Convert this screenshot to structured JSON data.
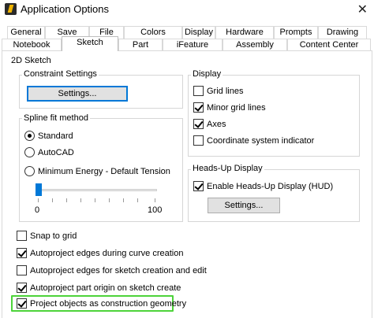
{
  "window": {
    "title": "Application Options",
    "close_glyph": "✕"
  },
  "tabs_row1": [
    "General",
    "Save",
    "File",
    "Colors",
    "Display",
    "Hardware",
    "Prompts",
    "Drawing"
  ],
  "tabs_row2": [
    "Notebook",
    "Sketch",
    "Part",
    "iFeature",
    "Assembly",
    "Content Center"
  ],
  "active_tab": "Sketch",
  "section_title": "2D Sketch",
  "constraint_settings": {
    "label": "Constraint Settings",
    "button": "Settings..."
  },
  "spline": {
    "label": "Spline fit method",
    "options": [
      {
        "label": "Standard",
        "checked": true
      },
      {
        "label": "AutoCAD",
        "checked": false
      },
      {
        "label": "Minimum Energy - Default Tension",
        "checked": false
      }
    ],
    "slider_min": "0",
    "slider_max": "100",
    "slider_value": 0
  },
  "display": {
    "label": "Display",
    "items": [
      {
        "label": "Grid lines",
        "checked": false
      },
      {
        "label": "Minor grid lines",
        "checked": true
      },
      {
        "label": "Axes",
        "checked": true
      },
      {
        "label": "Coordinate system indicator",
        "checked": false
      }
    ]
  },
  "hud": {
    "label": "Heads-Up Display",
    "enable": {
      "label": "Enable Heads-Up Display (HUD)",
      "checked": true
    },
    "button": "Settings..."
  },
  "options": [
    {
      "label": "Snap to grid",
      "checked": false
    },
    {
      "label": "Autoproject edges during curve creation",
      "checked": true
    },
    {
      "label": "Autoproject edges for sketch creation and edit",
      "checked": false
    },
    {
      "label": "Autoproject part origin on sketch create",
      "checked": true
    },
    {
      "label": "Project objects as construction geometry",
      "checked": true
    }
  ],
  "colors": {
    "highlight": "#4dd33a",
    "accent": "#0078d7"
  }
}
